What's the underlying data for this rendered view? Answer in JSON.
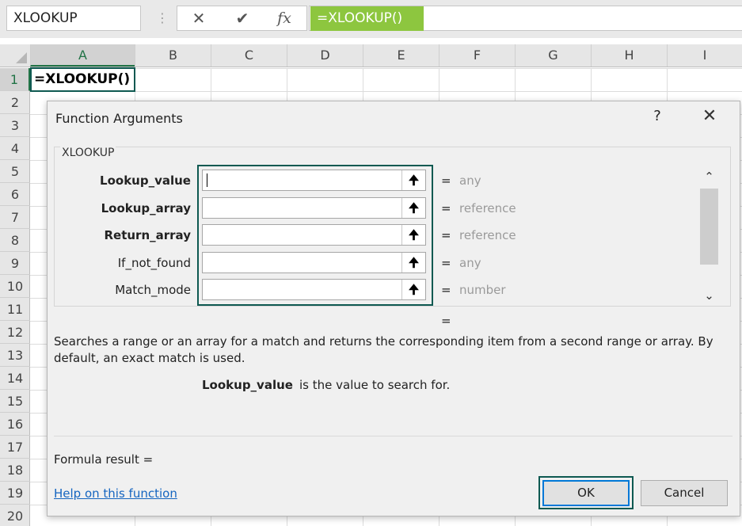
{
  "name_box": "XLOOKUP",
  "formula_bar": {
    "cancel_glyph": "✕",
    "enter_glyph": "✔",
    "fx_label": "fx",
    "formula": "=XLOOKUP()"
  },
  "columns": [
    "A",
    "B",
    "C",
    "D",
    "E",
    "F",
    "G",
    "H",
    "I"
  ],
  "rows": [
    "1",
    "2",
    "3",
    "4",
    "5",
    "6",
    "7",
    "8",
    "9",
    "10",
    "11",
    "12",
    "13",
    "14",
    "15",
    "16",
    "17",
    "18",
    "19",
    "20"
  ],
  "cell_a1": "=XLOOKUP()",
  "dialog": {
    "title": "Function Arguments",
    "help_glyph": "?",
    "close_glyph": "✕",
    "function_name": "XLOOKUP",
    "arguments": [
      {
        "label": "Lookup_value",
        "type": "any",
        "required": true
      },
      {
        "label": "Lookup_array",
        "type": "reference",
        "required": true
      },
      {
        "label": "Return_array",
        "type": "reference",
        "required": true
      },
      {
        "label": "If_not_found",
        "type": "any",
        "required": false
      },
      {
        "label": "Match_mode",
        "type": "number",
        "required": false
      }
    ],
    "equals": "=",
    "description": "Searches a range or an array for a match and returns the corresponding item from a second range or array. By default, an exact match is used.",
    "current_arg_name": "Lookup_value",
    "current_arg_desc": "is the value to search for.",
    "formula_result_label": "Formula result =",
    "help_link": "Help on this function",
    "ok_label": "OK",
    "cancel_label": "Cancel"
  }
}
